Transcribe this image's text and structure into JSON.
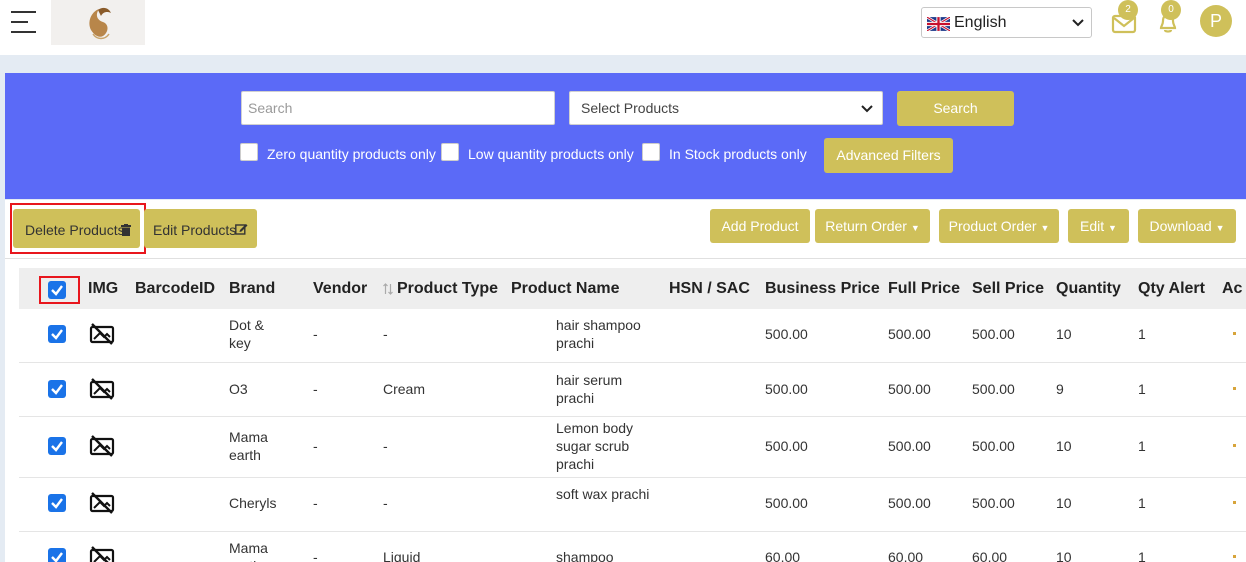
{
  "header": {
    "language": "English",
    "mail_count": "2",
    "notification_count": "0",
    "avatar_initial": "P"
  },
  "filters": {
    "search_placeholder": "Search",
    "select_placeholder": "Select Products",
    "search_button": "Search",
    "advanced_button": "Advanced Filters",
    "checkboxes": [
      "Zero quantity products only",
      "Low quantity products only",
      "In Stock products only"
    ]
  },
  "actions": {
    "delete_products": "Delete Products",
    "edit_products": "Edit Products",
    "add_product": "Add Product",
    "return_order": "Return Order",
    "product_order": "Product Order",
    "edit": "Edit",
    "download": "Download"
  },
  "table": {
    "columns": [
      "IMG",
      "BarcodeID",
      "Brand",
      "Vendor",
      "Product Type",
      "Product Name",
      "HSN / SAC",
      "Business Price",
      "Full Price",
      "Sell Price",
      "Quantity",
      "Qty Alert",
      "Ac"
    ],
    "rows": [
      {
        "barcode": "",
        "brand": "Dot & key",
        "vendor": "-",
        "type": "-",
        "name": "hair shampoo prachi",
        "hsn": "",
        "business": "500.00",
        "full": "500.00",
        "sell": "500.00",
        "qty": "10",
        "alert": "1"
      },
      {
        "barcode": "",
        "brand": "O3",
        "vendor": "-",
        "type": "Cream",
        "name": "hair serum prachi",
        "hsn": "",
        "business": "500.00",
        "full": "500.00",
        "sell": "500.00",
        "qty": "9",
        "alert": "1"
      },
      {
        "barcode": "",
        "brand": "Mama earth",
        "vendor": "-",
        "type": "-",
        "name": "Lemon body sugar scrub prachi",
        "hsn": "",
        "business": "500.00",
        "full": "500.00",
        "sell": "500.00",
        "qty": "10",
        "alert": "1"
      },
      {
        "barcode": "",
        "brand": "Cheryls",
        "vendor": "-",
        "type": "-",
        "name": "soft wax prachi",
        "hsn": "",
        "business": "500.00",
        "full": "500.00",
        "sell": "500.00",
        "qty": "10",
        "alert": "1"
      },
      {
        "barcode": "",
        "brand": "Mama earth",
        "vendor": "-",
        "type": "Liquid",
        "name": "shampoo",
        "hsn": "",
        "business": "60.00",
        "full": "60.00",
        "sell": "60.00",
        "qty": "10",
        "alert": "1"
      }
    ]
  },
  "colors": {
    "accent": "#cfc05a",
    "panel": "#5b6af7",
    "checkbox": "#1a73e8",
    "highlight": "#e8161d"
  }
}
